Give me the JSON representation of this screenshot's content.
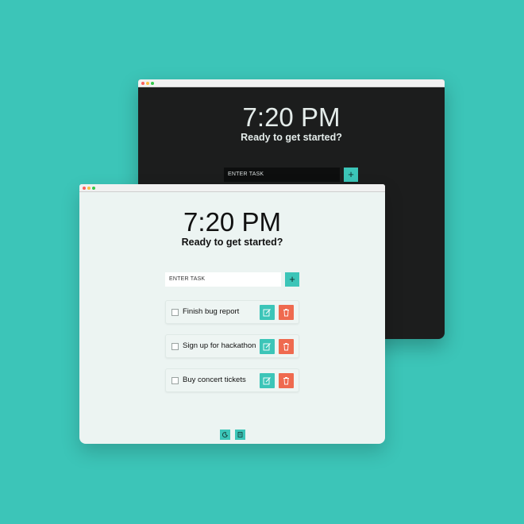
{
  "colors": {
    "background": "#3cc5b8",
    "accent": "#3cc5b8",
    "delete": "#ef6a4f",
    "dark_window_bg": "#1c1d1d",
    "light_window_bg": "#ecf4f2"
  },
  "dark_window": {
    "clock": "7:20 PM",
    "greeting": "Ready to get started?",
    "input_placeholder": "ENTER TASK",
    "add_label": "+"
  },
  "light_window": {
    "clock": "7:20 PM",
    "greeting": "Ready to get started?",
    "input_placeholder": "ENTER TASK",
    "add_label": "+",
    "tasks": [
      {
        "label": "Finish bug report",
        "checked": false
      },
      {
        "label": "Sign up for hackathon",
        "checked": false
      },
      {
        "label": "Buy concert tickets",
        "checked": false
      }
    ],
    "footer_icons": [
      "moon-icon",
      "document-icon"
    ]
  }
}
